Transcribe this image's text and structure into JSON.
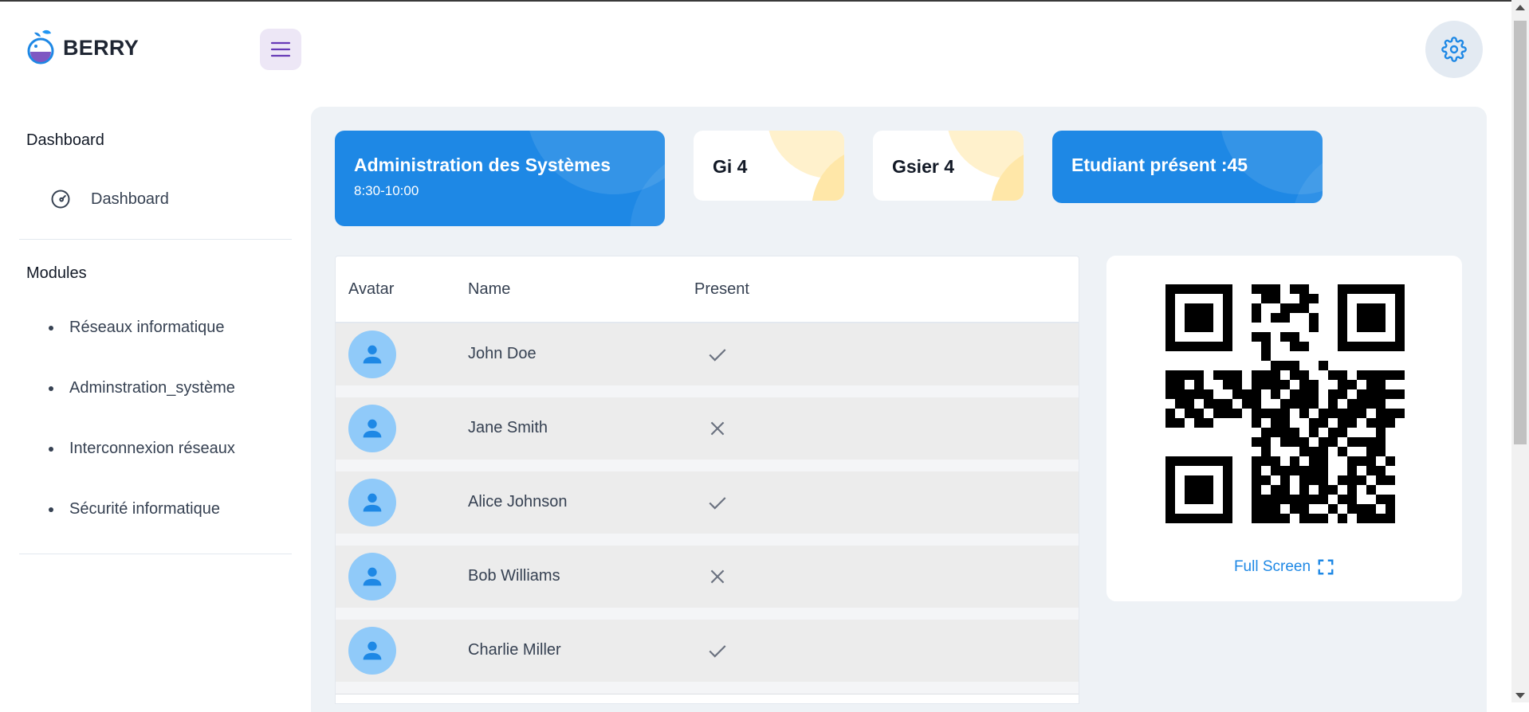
{
  "brand": {
    "name": "BERRY"
  },
  "sidebar": {
    "dashboard_section": "Dashboard",
    "dashboard_item": "Dashboard",
    "modules_section": "Modules",
    "modules": [
      {
        "label": "Réseaux informatique"
      },
      {
        "label": "Adminstration_système"
      },
      {
        "label": "Interconnexion réseaux"
      },
      {
        "label": "Sécurité informatique"
      }
    ]
  },
  "cards": {
    "course": {
      "title": "Administration des Systèmes",
      "time": "8:30-10:00"
    },
    "group1": {
      "title": "Gi 4"
    },
    "group2": {
      "title": "Gsier 4"
    },
    "present": {
      "title": "Etudiant présent :45"
    }
  },
  "table": {
    "headers": {
      "avatar": "Avatar",
      "name": "Name",
      "present": "Present"
    },
    "rows": [
      {
        "name": "John Doe",
        "present": true
      },
      {
        "name": "Jane Smith",
        "present": false
      },
      {
        "name": "Alice Johnson",
        "present": true
      },
      {
        "name": "Bob Williams",
        "present": false
      },
      {
        "name": "Charlie Miller",
        "present": true
      }
    ]
  },
  "qr": {
    "fullscreen_label": "Full Screen"
  },
  "colors": {
    "primary": "#1e88e5",
    "secondary": "#673ab7",
    "background": "#eef2f6",
    "avatar_bg": "#90caf9"
  }
}
